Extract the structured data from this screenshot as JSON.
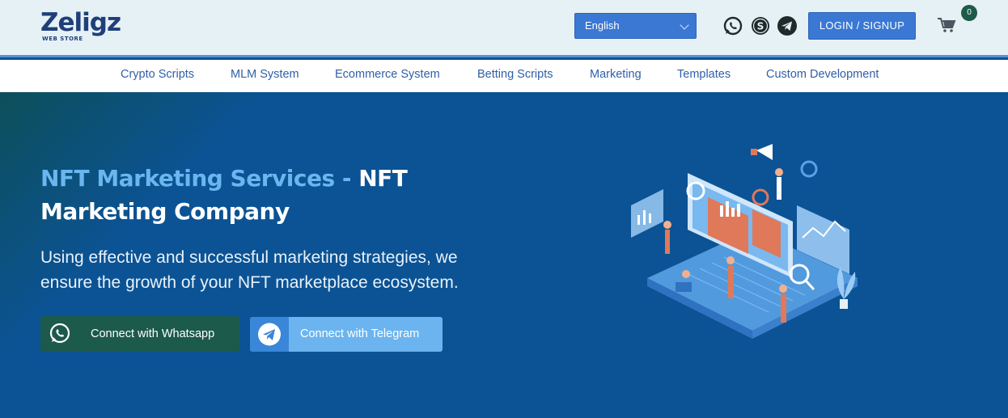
{
  "brand": {
    "logo_main": "Zeligz",
    "logo_sub": "WEB STORE"
  },
  "header": {
    "language": "English",
    "login_label": "LOGIN / SIGNUP",
    "cart_count": "0",
    "social_icons": [
      "whatsapp-icon",
      "skype-icon",
      "telegram-icon"
    ]
  },
  "nav": {
    "items": [
      {
        "label": "Crypto Scripts"
      },
      {
        "label": "MLM System"
      },
      {
        "label": "Ecommerce System"
      },
      {
        "label": "Betting Scripts"
      },
      {
        "label": "Marketing"
      },
      {
        "label": "Templates"
      },
      {
        "label": "Custom Development"
      }
    ]
  },
  "hero": {
    "title_highlight": "NFT Marketing Services - ",
    "title_rest_1": "NFT",
    "title_rest_2": "Marketing Company",
    "description": "Using effective and successful marketing strategies, we ensure the growth of your NFT marketplace ecosystem.",
    "whatsapp_button": "Connect with Whatsapp",
    "telegram_button": "Connect with Telegram"
  },
  "colors": {
    "hero_bg": "#0b5394",
    "accent_blue": "#3a78d4",
    "whatsapp_green": "#1c5a4c",
    "telegram_light": "#6bb4ef",
    "title_highlight": "#6ab6f0"
  }
}
